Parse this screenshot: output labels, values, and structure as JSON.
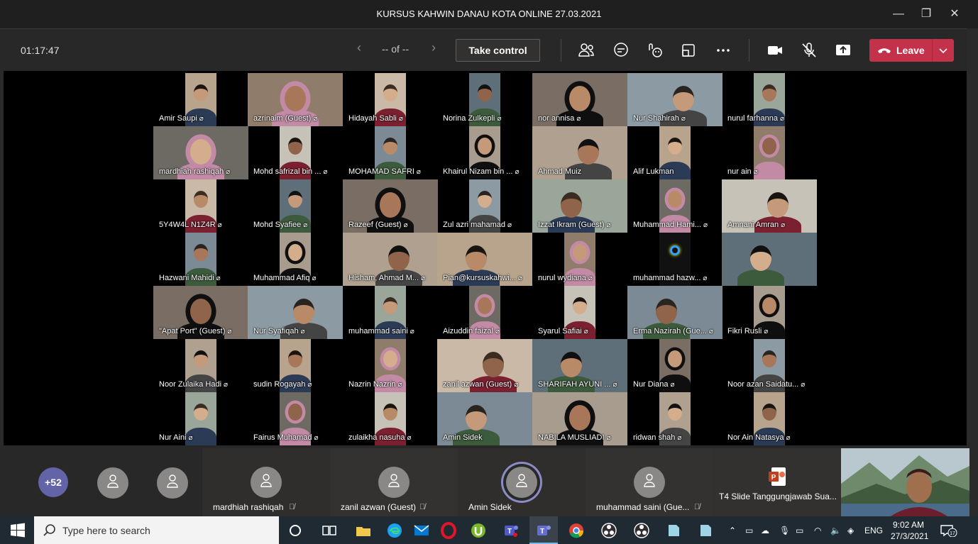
{
  "window": {
    "title": "KURSUS KAHWIN DANAU KOTA ONLINE 27.03.2021",
    "minimize": "—",
    "maximize": "❐",
    "close": "✕"
  },
  "toolbar": {
    "timer": "01:17:47",
    "pager": "-- of --",
    "prev": "‹",
    "next": "›",
    "take_control": "Take control",
    "leave": "Leave",
    "icons": [
      "participants-icon",
      "chat-icon",
      "reactions-icon",
      "share-tray-icon",
      "more-actions-icon",
      "camera-icon",
      "mic-muted-icon",
      "share-screen-icon"
    ]
  },
  "grid": [
    [
      {
        "name": "Amir Saupi",
        "mic": "🎤"
      },
      {
        "name": "azrinaim (Guest)",
        "mic": "🎤"
      },
      {
        "name": "Hidayah Sabli",
        "mic": "🎤"
      },
      {
        "name": "Norina Zulkepli",
        "mic": "🎤"
      },
      {
        "name": "nor annisa",
        "mic": "🎤"
      },
      {
        "name": "Nur Shahirah",
        "mic": "🎤"
      },
      {
        "name": "nurul farhanna",
        "mic": "🎤"
      }
    ],
    [
      {
        "name": "mardhiah rashiqah",
        "mic": "🎤"
      },
      {
        "name": "Mohd safrizal bin ...",
        "mic": "🎤"
      },
      {
        "name": "MOHAMAD SAFRI",
        "mic": "🎤"
      },
      {
        "name": "Khairul Nizam bin ...",
        "mic": "🎤"
      },
      {
        "name": "Ahmad Muiz",
        "mic": ""
      },
      {
        "name": "Alif Lukman",
        "mic": ""
      },
      {
        "name": "nur ain",
        "mic": "🎤"
      }
    ],
    [
      {
        "name": "5Y4W4L N1Z4R",
        "mic": "🎤"
      },
      {
        "name": "Mohd Syafiee",
        "mic": "🎤"
      },
      {
        "name": "Razeef (Guest)",
        "mic": "🎤"
      },
      {
        "name": "Zul azri mahamad",
        "mic": "🎤"
      },
      {
        "name": "Izzat Ikram (Guest)",
        "mic": "🎤"
      },
      {
        "name": "Muhammad Hami...",
        "mic": "🎤"
      },
      {
        "name": "Amnani Amran",
        "mic": "🎤"
      }
    ],
    [
      {
        "name": "Hazwani Mahidi",
        "mic": "🎤"
      },
      {
        "name": "Muhammad Afiq",
        "mic": "🎤"
      },
      {
        "name": "Hisham, Ahmad M...",
        "mic": "🎤"
      },
      {
        "name": "Pian@kursuskahwi...",
        "mic": "🎤"
      },
      {
        "name": "nurul wydiana",
        "mic": "🎤"
      },
      {
        "name": "muhammad hazw...",
        "mic": "🎤"
      },
      {
        "name": "",
        "mic": ""
      }
    ],
    [
      {
        "name": "\"Apat Port\" (Guest)",
        "mic": "🎤"
      },
      {
        "name": "Nur Syafiqah",
        "mic": "🎤"
      },
      {
        "name": "muhammad saini",
        "mic": "🎤"
      },
      {
        "name": "Aizuddin faizal",
        "mic": "🎤"
      },
      {
        "name": "Syarul Safiai",
        "mic": "🎤"
      },
      {
        "name": "Erma Nazirah (Gue...",
        "mic": "🎤"
      },
      {
        "name": "Fikri Rusli",
        "mic": "🎤"
      }
    ],
    [
      {
        "name": "Noor Zulaika Hadi",
        "mic": "🎤"
      },
      {
        "name": "sudin Rogayah",
        "mic": "🎤"
      },
      {
        "name": "Nazrin Nazrin",
        "mic": "🎤"
      },
      {
        "name": "zanil azwan (Guest)",
        "mic": "🎤"
      },
      {
        "name": "SHARIFAH AYUNI ...",
        "mic": "🎤"
      },
      {
        "name": "Nur Diana",
        "mic": "🎤"
      },
      {
        "name": "Noor azan Saidatu...",
        "mic": "🎤"
      }
    ],
    [
      {
        "name": "Nur Aini",
        "mic": "🎤"
      },
      {
        "name": "Fairus Muhamad",
        "mic": "🎤"
      },
      {
        "name": "zulaikha nasuha",
        "mic": "🎤"
      },
      {
        "name": "Amin Sidek",
        "mic": ""
      },
      {
        "name": "NABILA MUSLIADI",
        "mic": "🎤"
      },
      {
        "name": "ridwan shah",
        "mic": "🎤"
      },
      {
        "name": "Nor Ain Natasya",
        "mic": "🎤"
      }
    ]
  ],
  "bottom_bar": {
    "overflow_count": "+52",
    "participants": [
      {
        "name": "mardhiah rashiqah"
      },
      {
        "name": "zanil azwan (Guest)"
      },
      {
        "name": "Amin Sidek"
      },
      {
        "name": "muhammad saini (Gue..."
      }
    ],
    "shared_file": "T4 Slide Tanggungjawab Sua...",
    "colors": {
      "overflow": "#6264a7",
      "leave": "#c4314b",
      "speaking_ring": "#8b8cc7"
    }
  },
  "taskbar": {
    "search_placeholder": "Type here to search",
    "language": "ENG",
    "time": "9:02 AM",
    "date": "27/3/2021",
    "notifications": "17"
  }
}
